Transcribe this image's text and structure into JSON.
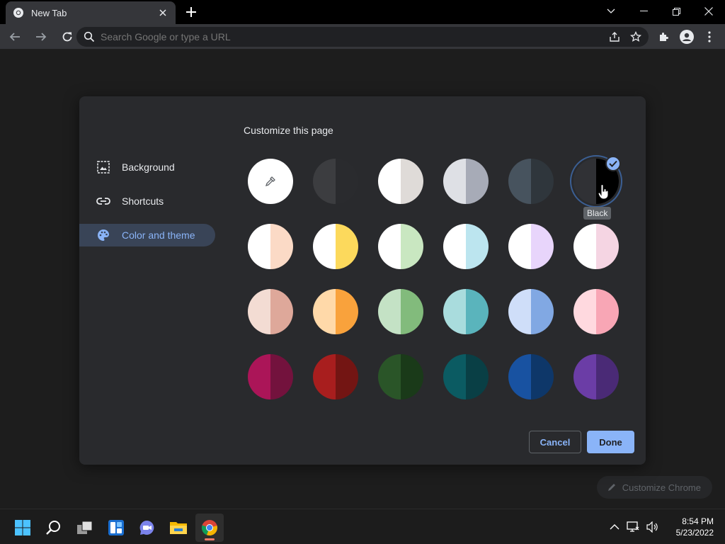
{
  "browser": {
    "tab_title": "New Tab",
    "omnibox_placeholder": "Search Google or type a URL"
  },
  "dialog": {
    "title": "Customize this page",
    "menu": [
      {
        "label": "Background",
        "icon": "image-icon"
      },
      {
        "label": "Shortcuts",
        "icon": "link-icon"
      },
      {
        "label": "Color and theme",
        "icon": "palette-icon",
        "active": true
      }
    ],
    "tooltip": "Black",
    "cancel_label": "Cancel",
    "done_label": "Done",
    "themes": [
      {
        "l": "#ffffff",
        "r": "#ffffff",
        "custom": true
      },
      {
        "l": "#3c3d40",
        "r": "#2a2b2e"
      },
      {
        "l": "#ffffff",
        "r": "#dfdbd8"
      },
      {
        "l": "#dee0e5",
        "r": "#a7abb7"
      },
      {
        "l": "#47535e",
        "r": "#2f363c"
      },
      {
        "l": "#303135",
        "r": "#000000",
        "selected": true
      },
      {
        "l": "#ffffff",
        "r": "#fbdac6"
      },
      {
        "l": "#ffffff",
        "r": "#fcd95c"
      },
      {
        "l": "#ffffff",
        "r": "#c9e7c1"
      },
      {
        "l": "#ffffff",
        "r": "#bce5ef"
      },
      {
        "l": "#ffffff",
        "r": "#e8d5fb"
      },
      {
        "l": "#ffffff",
        "r": "#f5d5e3"
      },
      {
        "l": "#f3dcd3",
        "r": "#dea89a"
      },
      {
        "l": "#ffd9a9",
        "r": "#f9a23c"
      },
      {
        "l": "#c4e2c5",
        "r": "#82bb7c"
      },
      {
        "l": "#a9dcdd",
        "r": "#5ab4bc"
      },
      {
        "l": "#cfdef9",
        "r": "#81a8e3"
      },
      {
        "l": "#ffd9df",
        "r": "#f8a6b5"
      },
      {
        "l": "#ab1558",
        "r": "#73123d"
      },
      {
        "l": "#a81e1e",
        "r": "#731513"
      },
      {
        "l": "#2a5528",
        "r": "#1a3a19"
      },
      {
        "l": "#0b5b62",
        "r": "#093f45"
      },
      {
        "l": "#1852a1",
        "r": "#0e3769"
      },
      {
        "l": "#6b3da6",
        "r": "#4a2a76"
      }
    ]
  },
  "page": {
    "customize_chrome_label": "Customize Chrome"
  },
  "taskbar": {
    "time": "8:54 PM",
    "date": "5/23/2022"
  }
}
